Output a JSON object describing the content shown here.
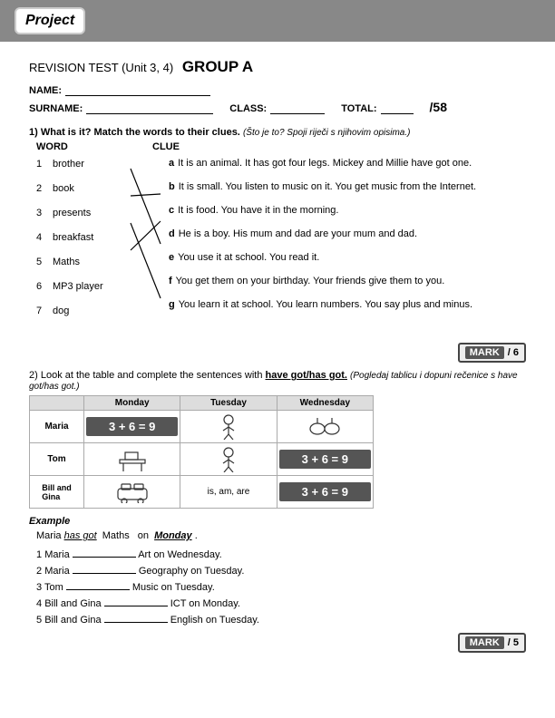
{
  "header": {
    "brand": "Project"
  },
  "test": {
    "title_prefix": "REVISION TEST (Unit 3, 4)",
    "title_suffix": "GROUP A",
    "name_label": "NAME:",
    "surname_label": "SURNAME:",
    "class_label": "CLASS:",
    "total_label": "TOTAL:",
    "total_value": "/58"
  },
  "section1": {
    "number": "1)",
    "instruction": "What is it? Match the words to their clues.",
    "instruction_note": "(Što je to? Spoji riječi s njihovim opisima.)",
    "col_word": "WORD",
    "col_clue": "CLUE",
    "words": [
      {
        "num": "1",
        "word": "brother"
      },
      {
        "num": "2",
        "word": "book"
      },
      {
        "num": "3",
        "word": "presents"
      },
      {
        "num": "4",
        "word": "breakfast"
      },
      {
        "num": "5",
        "word": "Maths"
      },
      {
        "num": "6",
        "word": "MP3 player"
      },
      {
        "num": "7",
        "word": "dog"
      }
    ],
    "clues": [
      {
        "letter": "a",
        "text": "It is an animal. It has got four legs. Mickey and Millie have got one."
      },
      {
        "letter": "b",
        "text": "It is small. You listen to music on it. You get music from the Internet."
      },
      {
        "letter": "c",
        "text": "It is food. You have it in the morning."
      },
      {
        "letter": "d",
        "text": "He is a boy. His mum and dad are your mum and dad."
      },
      {
        "letter": "e",
        "text": "You use it at school. You read it."
      },
      {
        "letter": "f",
        "text": "You get them on your birthday. Your friends give them to you."
      },
      {
        "letter": "g",
        "text": "You learn it at school. You learn numbers. You say plus and minus."
      }
    ],
    "mark_label": "MARK",
    "mark_value": "/ 6"
  },
  "section2": {
    "number": "2)",
    "instruction": "Look at the table and complete the sentences with",
    "highlight": "have got/has got.",
    "instruction_note": "(Pogledaj tablicu i dopuni rečenice s have got/has got.)",
    "table": {
      "col_headers": [
        "",
        "Monday",
        "Tuesday",
        "Wednesday"
      ],
      "rows": [
        {
          "name": "Maria",
          "monday": "3 + 6 = 9",
          "tuesday": "",
          "wednesday": ""
        },
        {
          "name": "Tom",
          "monday": "",
          "tuesday": "",
          "wednesday": "3 + 6 = 9"
        },
        {
          "name": "Bill and\nGina",
          "monday": "",
          "tuesday": "is, am, are",
          "wednesday": "3 + 6 = 9"
        }
      ]
    },
    "example_label": "Example",
    "example_text": "Maria",
    "example_has": "has got",
    "example_subject": "Maths",
    "example_on": "on",
    "example_day": "Monday",
    "sentences": [
      {
        "num": "1",
        "text": "Maria",
        "blank": true,
        "rest": "Art on Wednesday."
      },
      {
        "num": "2",
        "text": "Maria",
        "blank": true,
        "rest": "Geography on Tuesday."
      },
      {
        "num": "3",
        "text": "Tom",
        "blank": true,
        "rest": "Music on Tuesday."
      },
      {
        "num": "4",
        "text": "Bill and Gina",
        "blank": true,
        "rest": "ICT on Monday."
      },
      {
        "num": "5",
        "text": "Bill and Gina",
        "blank": true,
        "rest": "English on Tuesday."
      }
    ],
    "mark_label": "MARK",
    "mark_value": "/ 5"
  }
}
